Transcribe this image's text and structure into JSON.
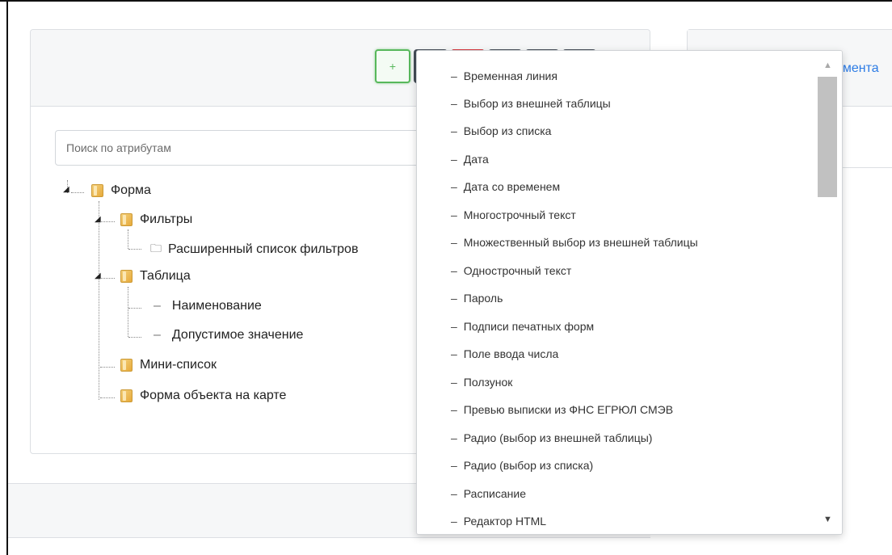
{
  "toolbar": {
    "add_label": "+"
  },
  "search": {
    "placeholder": "Поиск по атрибутам"
  },
  "tree": {
    "root": "Форма",
    "filters": "Фильтры",
    "filters_child": "Расширенный список фильтров",
    "table": "Таблица",
    "table_child_1": "Наименование",
    "table_child_2": "Допустимое значение",
    "mini_list": "Мини-список",
    "map_form": "Форма объекта на карте",
    "leaf_marker": "–"
  },
  "right_panel": {
    "link_fragment": "емента"
  },
  "dropdown": {
    "marker": "–",
    "items": [
      "Временная линия",
      "Выбор из внешней таблицы",
      "Выбор из списка",
      "Дата",
      "Дата со временем",
      "Многострочный текст",
      "Множественный выбор из внешней таблицы",
      "Однострочный текст",
      "Пароль",
      "Подписи печатных форм",
      "Поле ввода числа",
      "Ползунок",
      "Превью выписки из ФНС ЕГРЮЛ СМЭВ",
      "Радио (выбор из внешней таблицы)",
      "Радио (выбор из списка)",
      "Расписание",
      "Редактор HTML"
    ]
  },
  "colors": {
    "accent_green": "#58b85c",
    "link_blue": "#2c7be5",
    "toolbar_dark": "#444d57",
    "toolbar_red": "#d9343b"
  }
}
